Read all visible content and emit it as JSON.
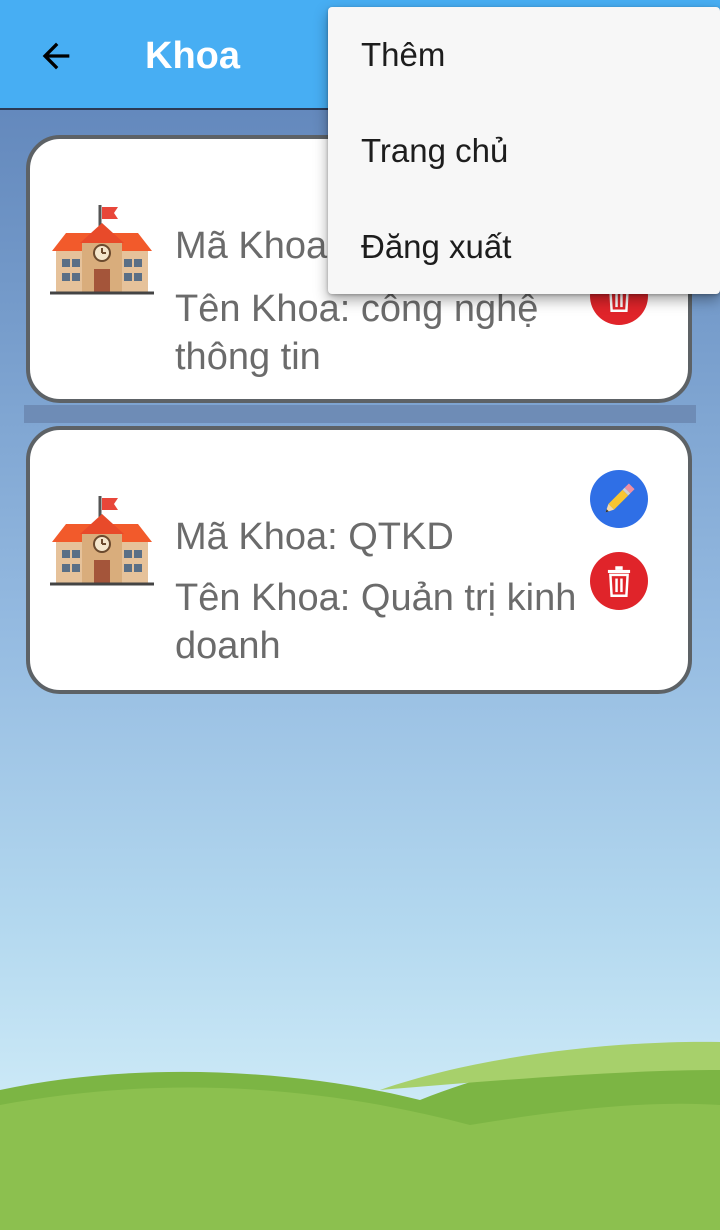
{
  "app_bar": {
    "title": "Khoa",
    "back_icon": "arrow-left-icon",
    "background": "#47aef3"
  },
  "faculties": [
    {
      "code_text": "Mã Khoa",
      "name_text": "Tên Khoa: công nghệ thông tin",
      "icon": "school-icon"
    },
    {
      "code_text": "Mã Khoa: QTKD",
      "name_text": "Tên Khoa: Quản trị kinh doanh",
      "icon": "school-icon"
    }
  ],
  "actions": {
    "edit_icon": "pencil-icon",
    "delete_icon": "trash-icon",
    "edit_color": "#2f6fe6",
    "delete_color": "#e0242a"
  },
  "overflow_menu": {
    "items": [
      "Thêm",
      "Trang chủ",
      "Đăng xuất"
    ]
  }
}
